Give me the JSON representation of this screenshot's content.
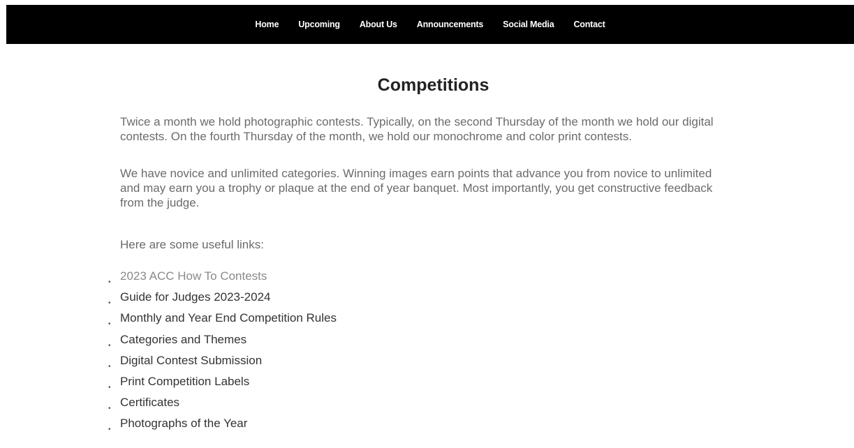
{
  "nav": {
    "items": [
      {
        "label": "Home"
      },
      {
        "label": "Upcoming"
      },
      {
        "label": "About Us"
      },
      {
        "label": "Announcements"
      },
      {
        "label": "Social Media"
      },
      {
        "label": "Contact"
      }
    ]
  },
  "main": {
    "title": "Competitions",
    "paragraph1": "Twice a month we hold photographic contests. Typically, on the second Thursday of the month we hold our digital contests. On the fourth Thursday of the month, we hold our monochrome and color print contests.",
    "paragraph2": "We have novice and unlimited categories. Winning images earn points that advance you from novice to unlimited and may earn you a trophy or plaque at the end of year banquet. Most importantly, you get constructive feedback from the judge.",
    "links_intro": "Here are some useful links:",
    "bullet_glyph": "•",
    "links": [
      {
        "label": "2023 ACC How To Contests"
      },
      {
        "label": "Guide for Judges 2023-2024"
      },
      {
        "label": "Monthly and Year End Competition Rules"
      },
      {
        "label": "Categories and Themes"
      },
      {
        "label": "Digital Contest Submission"
      },
      {
        "label": "Print Competition Labels"
      },
      {
        "label": "Certificates"
      },
      {
        "label": "Photographs of the Year"
      }
    ]
  },
  "colors": {
    "nav_background": "#000000",
    "nav_text": "#ffffff",
    "heading": "#222222",
    "body_text": "#6b6b6b",
    "link_text": "#333333",
    "visited_link": "#8a8a8a"
  }
}
